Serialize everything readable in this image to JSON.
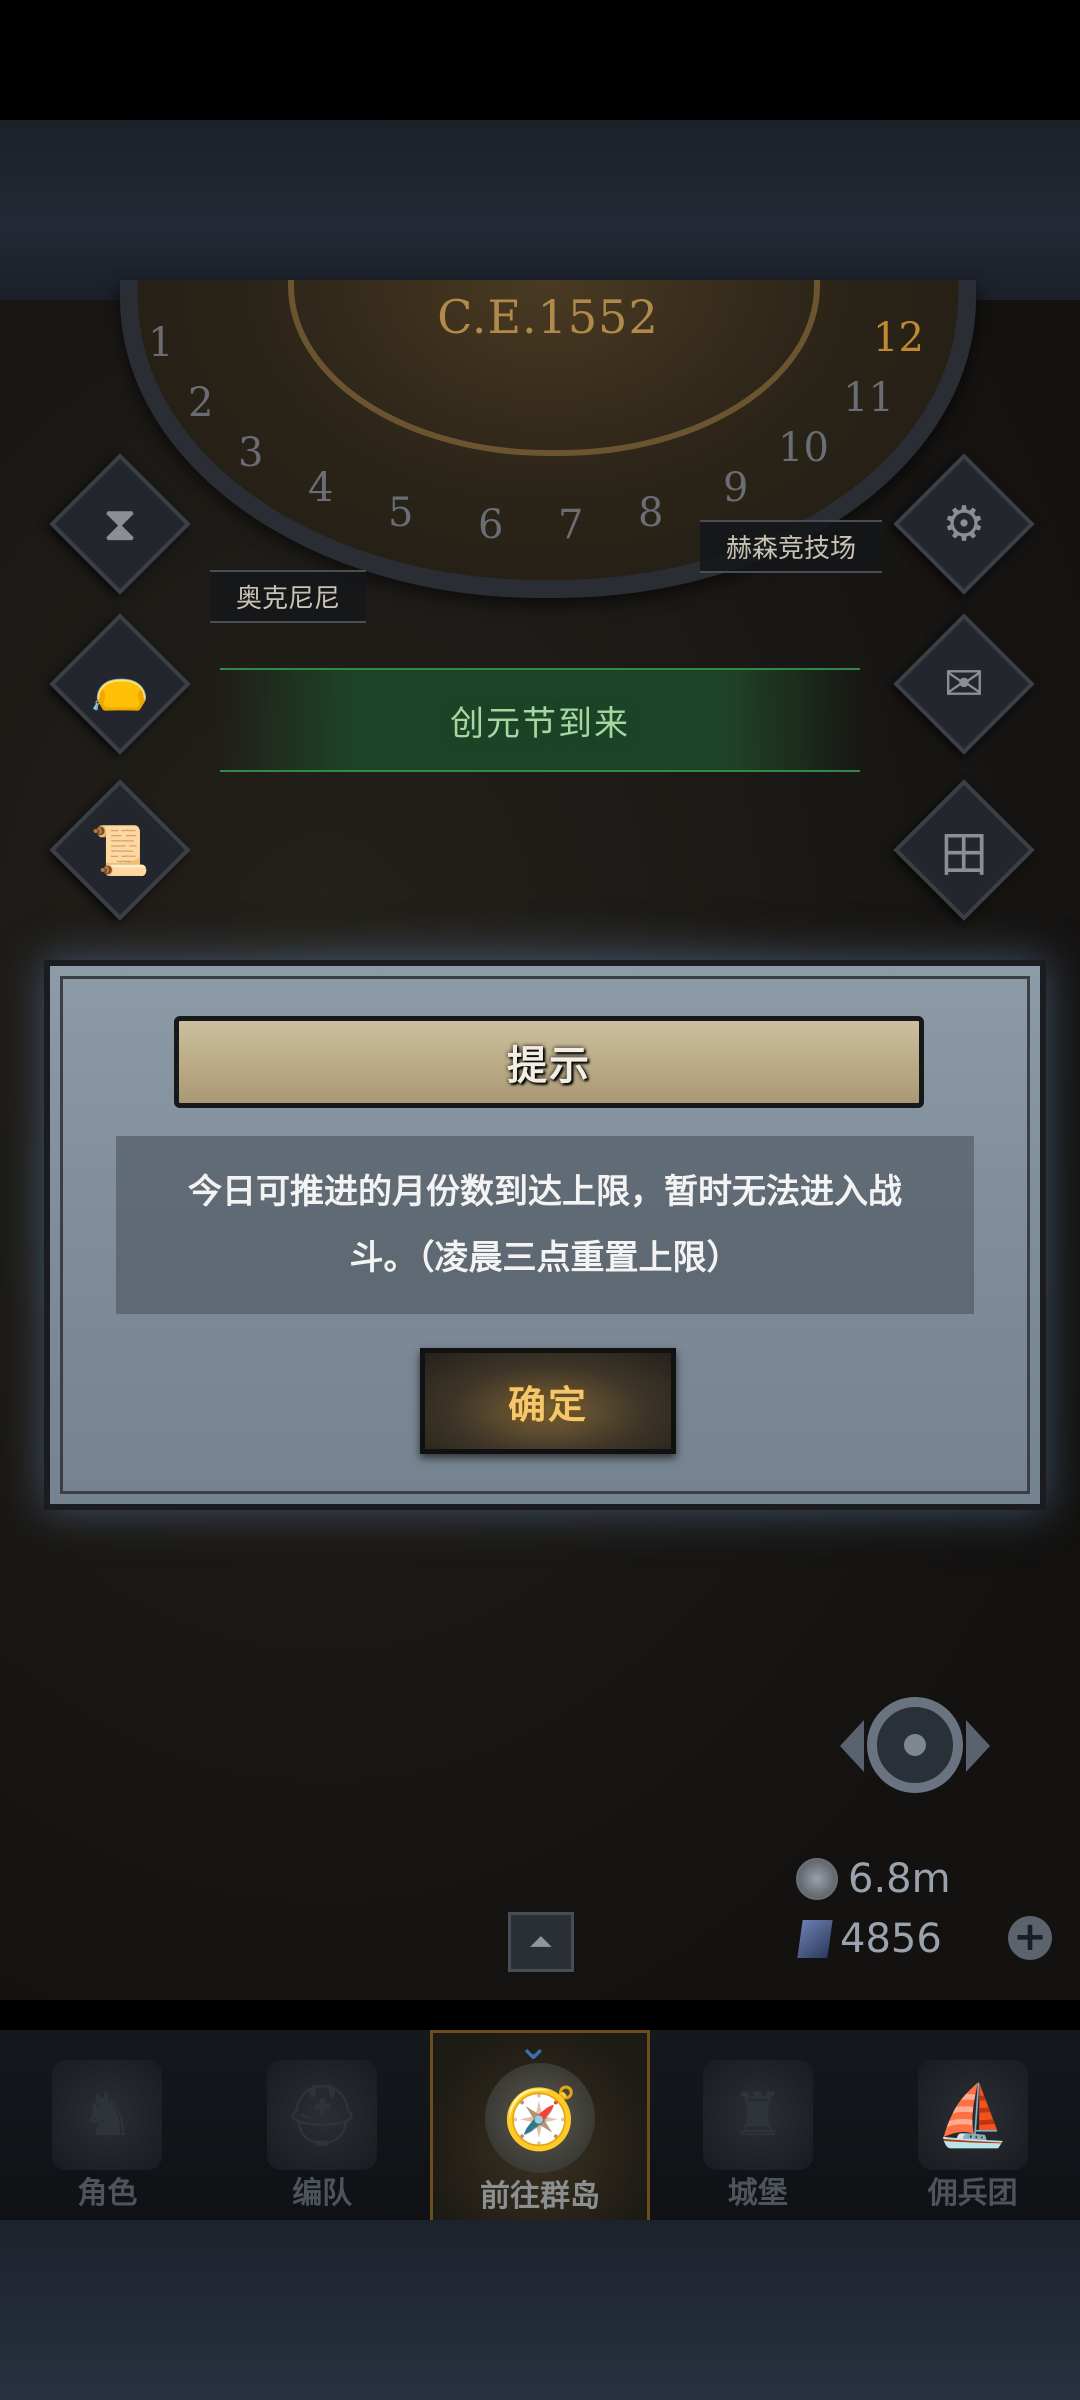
{
  "top": {
    "year": "C.E.1552",
    "months": [
      "1",
      "2",
      "3",
      "4",
      "5",
      "6",
      "7",
      "8",
      "9",
      "10",
      "11",
      "12"
    ]
  },
  "map": {
    "place_left": "奥克尼尼",
    "place_right": "赫森竞技场",
    "event_banner": "创元节到来"
  },
  "resources": {
    "silver": "6.8m",
    "gems": "4856"
  },
  "dialog": {
    "title": "提示",
    "message": "今日可推进的月份数到达上限，暂时无法进入战斗。（凌晨三点重置上限）",
    "confirm": "确定"
  },
  "nav": {
    "items": [
      {
        "label": "角色"
      },
      {
        "label": "编队"
      },
      {
        "label": "前往群岛"
      },
      {
        "label": "城堡"
      },
      {
        "label": "佣兵团"
      }
    ]
  }
}
